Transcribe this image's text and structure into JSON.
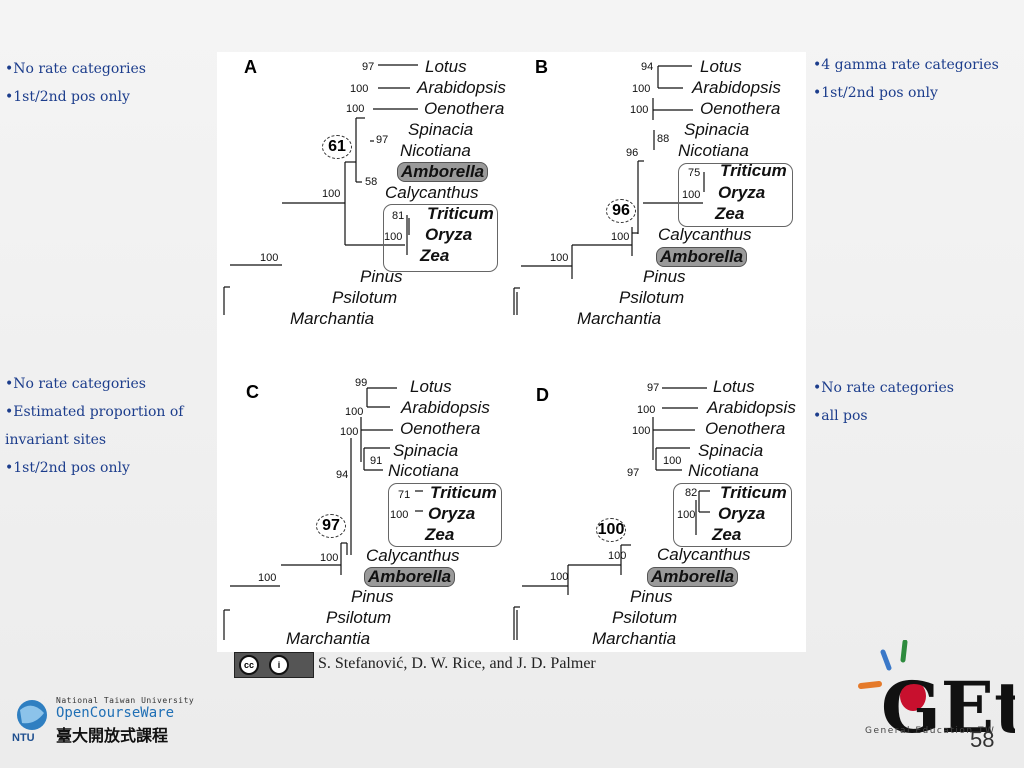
{
  "slide": {
    "blocks": [
      [
        "•No rate categories",
        "•1st/2nd pos only"
      ],
      [
        "•4 gamma rate categories",
        "•1st/2nd pos only"
      ],
      [
        "•No rate categories",
        "•Estimated proportion of invariant sites",
        "•1st/2nd pos only"
      ],
      [
        "•No rate categories",
        "•all pos"
      ]
    ]
  },
  "figure": {
    "panels": [
      {
        "label": "A",
        "circled": "61",
        "support": [
          "97",
          "100",
          "100",
          "97",
          "58",
          "100",
          "81",
          "100",
          "100"
        ],
        "taxa": [
          "Lotus",
          "Arabidopsis",
          "Oenothera",
          "Spinacia",
          "Nicotiana",
          "Amborella",
          "Calycanthus",
          "Triticum",
          "Oryza",
          "Zea",
          "Pinus",
          "Psilotum",
          "Marchantia"
        ]
      },
      {
        "label": "B",
        "circled": "96",
        "support": [
          "94",
          "100",
          "100",
          "88",
          "96",
          "75",
          "100",
          "100",
          "100"
        ],
        "taxa": [
          "Lotus",
          "Arabidopsis",
          "Oenothera",
          "Spinacia",
          "Nicotiana",
          "Triticum",
          "Oryza",
          "Zea",
          "Calycanthus",
          "Amborella",
          "Pinus",
          "Psilotum",
          "Marchantia"
        ]
      },
      {
        "label": "C",
        "circled": "97",
        "support": [
          "99",
          "100",
          "100",
          "91",
          "94",
          "71",
          "100",
          "100",
          "100"
        ],
        "taxa": [
          "Lotus",
          "Arabidopsis",
          "Oenothera",
          "Spinacia",
          "Nicotiana",
          "Triticum",
          "Oryza",
          "Zea",
          "Calycanthus",
          "Amborella",
          "Pinus",
          "Psilotum",
          "Marchantia"
        ]
      },
      {
        "label": "D",
        "circled": "100",
        "support": [
          "97",
          "100",
          "100",
          "100",
          "97",
          "82",
          "100",
          "100",
          "100"
        ],
        "taxa": [
          "Lotus",
          "Arabidopsis",
          "Oenothera",
          "Spinacia",
          "Nicotiana",
          "Triticum",
          "Oryza",
          "Zea",
          "Calycanthus",
          "Amborella",
          "Pinus",
          "Psilotum",
          "Marchantia"
        ]
      }
    ],
    "highlight_color": "#9a9a9a"
  },
  "citation": "S. Stefanović, D. W. Rice, and J. D. Palmer",
  "license": {
    "icons": [
      "cc-icon",
      "by-icon"
    ],
    "by_label": "BY"
  },
  "logos": {
    "ntu_line1": "National Taiwan University",
    "ntu_line2": "OpenCourseWare",
    "ntu_line3": "臺大開放式課程",
    "ntu_short": "NTU",
    "get_mark": "GEt",
    "get_caption": "General Education TW"
  },
  "page_number": "58",
  "colors": {
    "bullet_text": "#1c3d8c",
    "get_red": "#c8102e",
    "ocw_blue": "#1f6fb5"
  }
}
